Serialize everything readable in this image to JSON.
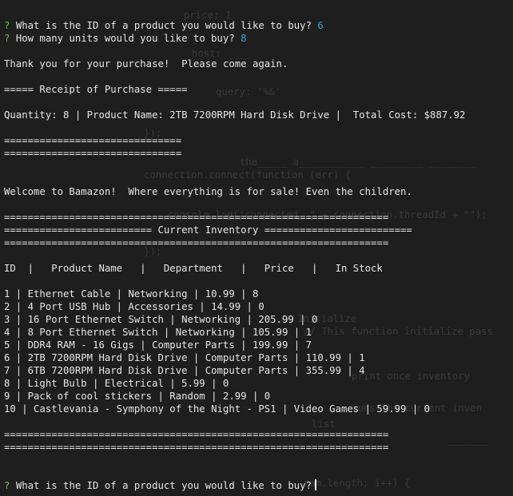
{
  "terminal": {
    "colors": {
      "background": "#1e1e1e",
      "text": "#e6e6e6",
      "prompt_mark": "#6fbf4a",
      "answer": "#3fa2d8"
    },
    "prompt1": {
      "mark": "?",
      "question": "What is the ID of a product you would like to buy?",
      "answer": "6"
    },
    "prompt2": {
      "mark": "?",
      "question": "How many units would you like to buy?",
      "answer": "8"
    },
    "thank_you": "Thank you for your purchase!  Please come again.",
    "receipt_header": "===== Receipt of Purchase =====",
    "receipt_line": "Quantity: 8 | Product Name: 2TB 7200RPM Hard Disk Drive |  Total Cost: $887.92",
    "receipt_rule1": "==============================",
    "receipt_rule2": "==============================",
    "welcome": "Welcome to Bamazon!  Where everything is for sale! Even the children.",
    "inventory_rule_top": "=================================================================",
    "inventory_title": "========================= Current Inventory =========================",
    "inventory_rule_mid": "=================================================================",
    "columns": "ID  |   Product Name   |   Department   |   Price   |   In Stock",
    "rows": [
      "1 | Ethernet Cable | Networking | 10.99 | 8",
      "2 | 4 Port USB Hub | Accessories | 14.99 | 0",
      "3 | 16 Port Ethernet Switch | Networking | 205.99 | 0",
      "4 | 8 Port Ethernet Switch | Networking | 105.99 | 1",
      "5 | DDR4 RAM - 16 Gigs | Computer Parts | 199.99 | 7",
      "6 | 2TB 7200RPM Hard Disk Drive | Computer Parts | 110.99 | 1",
      "7 | 6TB 7200RPM Hard Disk Drive | Computer Parts | 355.99 | 4",
      "8 | Light Bulb | Electrical | 5.99 | 0",
      "9 | Pack of cool stickers | Random | 2.99 | 0",
      "10 | Castlevania - Symphony of the Night - PS1 | Video Games | 59.99 | 0"
    ],
    "inventory_rule_bottom1": "=================================================================",
    "inventory_rule_bottom2": "=================================================================",
    "prompt3": {
      "mark": "?",
      "question": "What is the ID of a product you would like to buy?"
    }
  }
}
